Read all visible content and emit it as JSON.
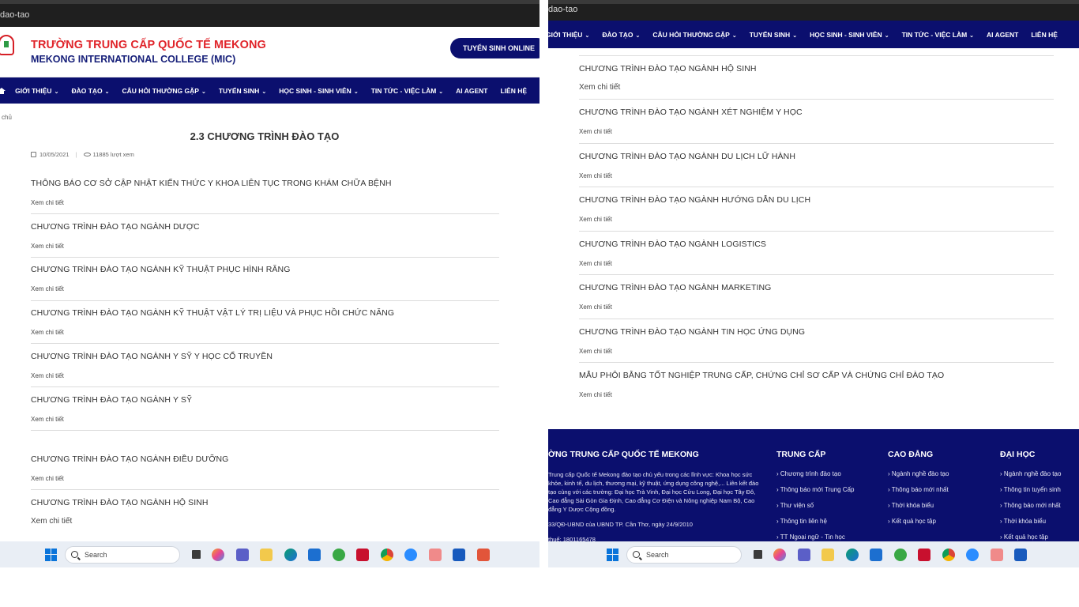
{
  "left": {
    "url": "dao-tao",
    "brand": {
      "name_vn": "TRƯỜNG TRUNG CẤP QUỐC TẾ MEKONG",
      "name_en": "MEKONG INTERNATIONAL COLLEGE (MIC)",
      "online_button": "TUYỂN SINH ONLINE"
    },
    "nav": [
      "GIỚI THIỆU",
      "ĐÀO TẠO",
      "CÂU HỎI THƯỜNG GẶP",
      "TUYỂN SINH",
      "HỌC SINH - SINH VIÊN",
      "TIN TỨC - VIỆC LÀM",
      "AI AGENT",
      "LIÊN HỆ"
    ],
    "breadcrumb": "chủ",
    "title": "2.3 CHƯƠNG TRÌNH ĐÀO TẠO",
    "date": "10/05/2021",
    "views": "11885 lượt xem",
    "more_label": "Xem chi tiết",
    "entries": [
      "THÔNG BÁO CƠ SỞ CẬP NHẬT KIẾN THỨC Y KHOA LIÊN TỤC TRONG KHÁM CHỮA BỆNH",
      "CHƯƠNG TRÌNH ĐÀO TẠO NGÀNH DƯỢC",
      "CHƯƠNG TRÌNH ĐÀO TẠO NGÀNH KỸ THUẬT PHỤC HÌNH RĂNG",
      "CHƯƠNG TRÌNH ĐÀO TẠO NGÀNH KỸ THUẬT VẬT LÝ TRỊ LIỆU VÀ PHỤC HỒI CHỨC NĂNG",
      "CHƯƠNG TRÌNH ĐÀO TẠO NGÀNH Y SỸ Y HỌC CỔ TRUYỀN",
      "CHƯƠNG TRÌNH ĐÀO TẠO NGÀNH Y SỸ",
      "CHƯƠNG TRÌNH ĐÀO TẠO NGÀNH ĐIỀU DƯỠNG",
      "CHƯƠNG TRÌNH ĐÀO TẠO NGÀNH HỘ SINH"
    ],
    "taskbar_search": "Search"
  },
  "right": {
    "url": "dao-tao",
    "nav": [
      "GIỚI THIỆU",
      "ĐÀO TẠO",
      "CÂU HỎI THƯỜNG GẶP",
      "TUYỂN SINH",
      "HỌC SINH - SINH VIÊN",
      "TIN TỨC - VIỆC LÀM",
      "AI AGENT",
      "LIÊN HỆ"
    ],
    "more_label": "Xem chi tiết",
    "entries": [
      "CHƯƠNG TRÌNH ĐÀO TẠO NGÀNH HỘ SINH",
      "CHƯƠNG TRÌNH ĐÀO TẠO NGÀNH XÉT NGHIỆM Y HỌC",
      "CHƯƠNG TRÌNH ĐÀO TẠO NGÀNH DU LỊCH LỮ HÀNH",
      "CHƯƠNG TRÌNH ĐÀO TẠO NGÀNH HƯỚNG DẪN DU LỊCH",
      "CHƯƠNG TRÌNH ĐÀO TẠO NGÀNH LOGISTICS",
      "CHƯƠNG TRÌNH ĐÀO TẠO NGÀNH MARKETING",
      "CHƯƠNG TRÌNH ĐÀO TẠO NGÀNH TIN HỌC ỨNG DỤNG",
      "MẪU PHÔI BẰNG TỐT NGHIỆP TRUNG CẤP, CHỨNG CHỈ SƠ CẤP VÀ CHỨNG CHỈ ĐÀO TẠO"
    ],
    "footer": {
      "school_title": "ỜNG TRUNG CẤP QUỐC TẾ MEKONG",
      "school_desc": "Trung cấp Quốc tế Mekong đào tạo chủ yếu trong các lĩnh vực: Khoa học sức khỏe, kinh tế, du lịch, thương mại, kỹ thuật, ứng dụng công nghệ,... Liên kết đào tạo cùng với các trường: Đại học Trà Vinh, Đại học Cửu Long, Đại học Tây Đô, Cao đẳng Sài Gòn Gia Định, Cao đẳng Cơ Điện và Nông nghiệp Nam Bộ, Cao đẳng Y Dược Cộng đồng.",
      "decision": "33/QĐ-UBND của UBND TP. Cần Thơ, ngày 24/9/2010",
      "tax": "thuế: 1801165478",
      "col_trung_cap": {
        "title": "TRUNG CẤP",
        "links": [
          "Chương trình đào tạo",
          "Thông báo mới Trung Cấp",
          "Thư viện số",
          "Thông tin liên hệ",
          "TT Ngoại ngữ - Tin học"
        ]
      },
      "col_cao_dang": {
        "title": "CAO ĐẲNG",
        "links": [
          "Ngành nghề đào tạo",
          "Thông báo mới nhất",
          "Thời khóa biểu",
          "Kết quả học tập"
        ]
      },
      "col_dai_hoc": {
        "title": "ĐẠI HỌC",
        "links": [
          "Ngành nghề đào tạo",
          "Thông tin tuyển sinh",
          "Thông báo mới nhất",
          "Thời khóa biểu",
          "Kết quả học tập"
        ]
      }
    },
    "taskbar_search": "Search"
  },
  "taskbar_icons": [
    "widgets-icon",
    "task-view-icon",
    "copilot-icon",
    "teams-icon",
    "file-explorer-icon",
    "edge-icon",
    "store-icon",
    "game-icon",
    "mcafee-icon",
    "chrome-icon",
    "zalo-icon",
    "app-pinned-icon",
    "word-icon",
    "snipping-tool-icon"
  ],
  "colors": {
    "navy": "#0b0f6e",
    "red": "#e0242a"
  }
}
